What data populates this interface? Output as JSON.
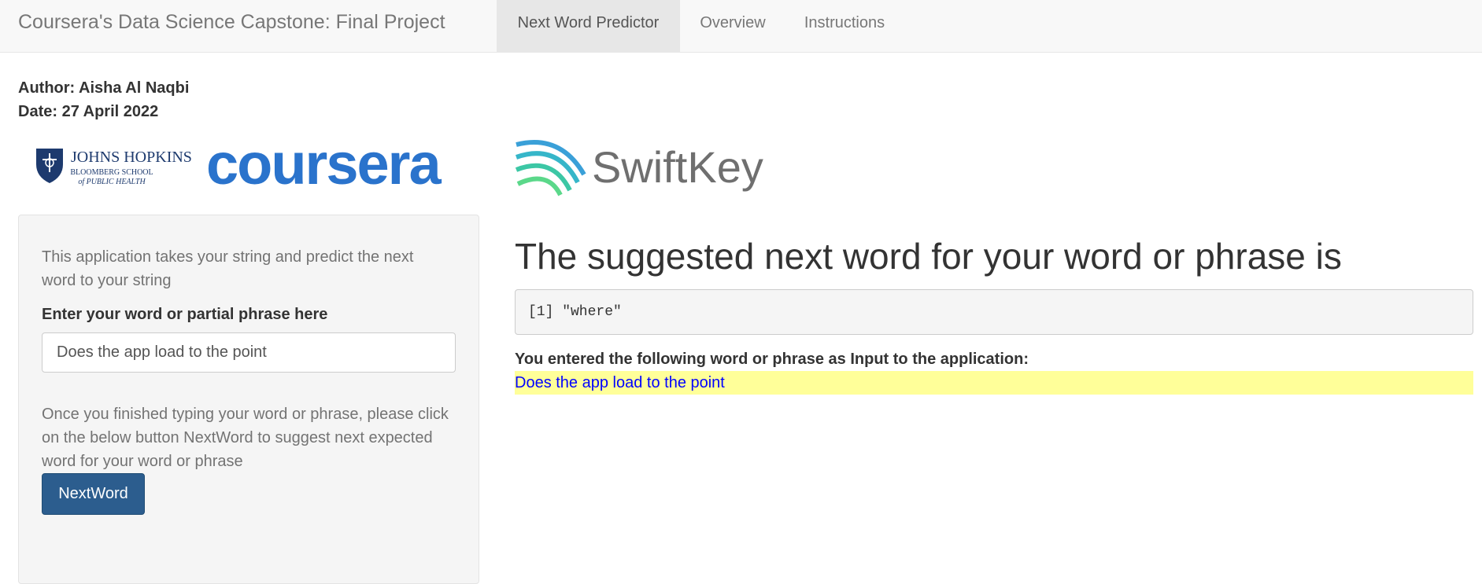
{
  "navbar": {
    "brand": "Coursera's Data Science Capstone: Final Project",
    "tabs": [
      {
        "label": "Next Word Predictor",
        "active": true
      },
      {
        "label": "Overview",
        "active": false
      },
      {
        "label": "Instructions",
        "active": false
      }
    ]
  },
  "meta": {
    "author": "Author: Aisha Al Naqbi",
    "date": "Date: 27 April 2022"
  },
  "logos": {
    "jhu": {
      "line1": "JOHNS HOPKINS",
      "line2": "BLOOMBERG SCHOOL",
      "line3": "of PUBLIC HEALTH"
    },
    "coursera": "coursera",
    "swiftkey": "SwiftKey"
  },
  "sidebar": {
    "description": "This application takes your string and predict the next word to your string",
    "input_label": "Enter your word or partial phrase here",
    "input_value": "Does the app load to the point",
    "instructions": "Once you finished typing your word or phrase, please click on the below button NextWord to suggest next expected word for your word or phrase",
    "button_label": "NextWord"
  },
  "main": {
    "heading": "The suggested next word for your word or phrase is",
    "prediction_output": "[1] \"where\"",
    "entered_label": "You entered the following word or phrase as Input to the application:",
    "entered_value": "Does the app load to the point"
  },
  "colors": {
    "primary_button": "#2c5d8e",
    "highlight": "#ffff99",
    "entered_text": "#0000ff",
    "coursera_blue": "#2a73cc"
  }
}
